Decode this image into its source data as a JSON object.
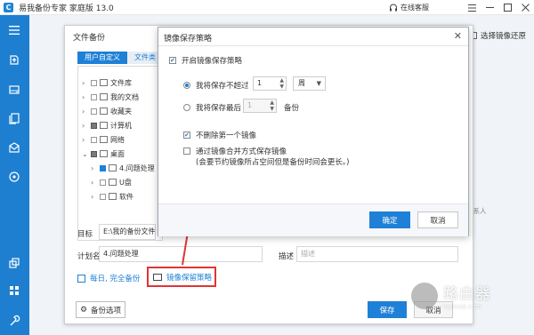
{
  "app": {
    "title": "易我备份专家 家庭版 13.0",
    "logo_letter": "C",
    "online_service": "在线客服"
  },
  "sidebar": {
    "items": [
      {
        "icon": "menu-icon"
      },
      {
        "icon": "backup-icon"
      },
      {
        "icon": "disk-icon"
      },
      {
        "icon": "files-icon"
      },
      {
        "icon": "mail-icon"
      },
      {
        "icon": "target-icon"
      },
      {
        "icon": "clone-icon"
      },
      {
        "icon": "apps-icon"
      },
      {
        "icon": "tools-icon"
      }
    ]
  },
  "background": {
    "restore_label": "选择镜像还原",
    "side_link": "联系人"
  },
  "file_backup": {
    "title": "文件备份",
    "tabs": [
      {
        "label": "用户自定义"
      },
      {
        "label": "文件类"
      }
    ],
    "tree": [
      {
        "label": "文件库",
        "expanded": false,
        "check": "none"
      },
      {
        "label": "我的文档",
        "expanded": false,
        "check": "none"
      },
      {
        "label": "收藏夹",
        "expanded": false,
        "check": "none"
      },
      {
        "label": "计算机",
        "expanded": false,
        "check": "partial"
      },
      {
        "label": "网络",
        "expanded": false,
        "check": "none"
      },
      {
        "label": "桌面",
        "expanded": true,
        "check": "partial"
      },
      {
        "label": "4.问题处理",
        "expanded": false,
        "check": "checked"
      },
      {
        "label": "U盘",
        "expanded": false,
        "check": "none"
      },
      {
        "label": "软件",
        "expanded": false,
        "check": "none"
      }
    ],
    "target_label": "目标",
    "target_value": "E:\\我的备份文件",
    "plan_label": "计划名",
    "plan_value": "4.问题处理",
    "desc_label": "描述",
    "desc_placeholder": "描述",
    "schedule": "每日, 完全备份",
    "policy_link": "镜像保留策略",
    "options_button": "备份选项",
    "save_button": "保存",
    "cancel_button": "取消"
  },
  "dialog": {
    "title": "镜像保存策略",
    "enable_label": "开启镜像保存策略",
    "enable_checked": true,
    "option1_label": "我将保存不超过",
    "option1_value": "1",
    "option1_unit": "周",
    "option1_selected": true,
    "option2_label": "我将保存最后",
    "option2_value": "1",
    "option2_unit": "备份",
    "option2_selected": false,
    "keep_first_label": "不删除第一个镜像",
    "keep_first_checked": true,
    "merge_label": "通过镜像合并方式保存镜像",
    "merge_note": "(会要节约镜像所占空间但是备份时间会更长。)",
    "merge_checked": false,
    "ok_button": "确定",
    "cancel_button": "取消"
  },
  "annotation": {
    "color": "#e03434"
  },
  "watermark": {
    "main": "路由器",
    "sub": "luyouqi.com"
  }
}
